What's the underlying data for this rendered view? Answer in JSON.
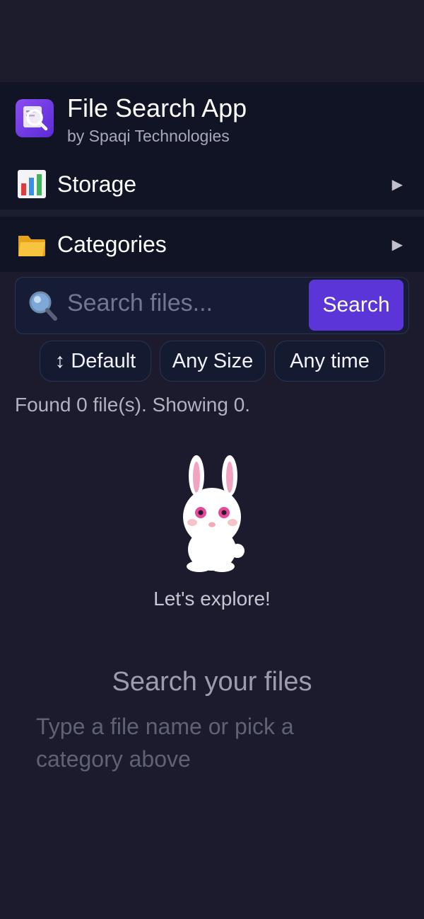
{
  "header": {
    "title": "File Search App",
    "subtitle": "by Spaqi Technologies",
    "logo_icon": "magnifier-document-icon",
    "accent": "#5b35d8"
  },
  "sections": {
    "storage": {
      "label": "Storage",
      "icon": "bar-chart-icon",
      "arrow": "▶"
    },
    "categories": {
      "label": "Categories",
      "icon": "folder-icon",
      "arrow": "▶"
    }
  },
  "search": {
    "placeholder": "Search files...",
    "value": "",
    "button_label": "Search",
    "icon": "magnifier-icon"
  },
  "filters": {
    "sort_label": "↕ Default",
    "size_label": "Any Size",
    "time_label": "Any time"
  },
  "results": {
    "summary": "Found 0 file(s). Showing 0."
  },
  "empty_state": {
    "illustration": "bunny-illustration",
    "caption": "Let's explore!",
    "title": "Search your files",
    "hint": "Type a file name or pick a category above"
  }
}
